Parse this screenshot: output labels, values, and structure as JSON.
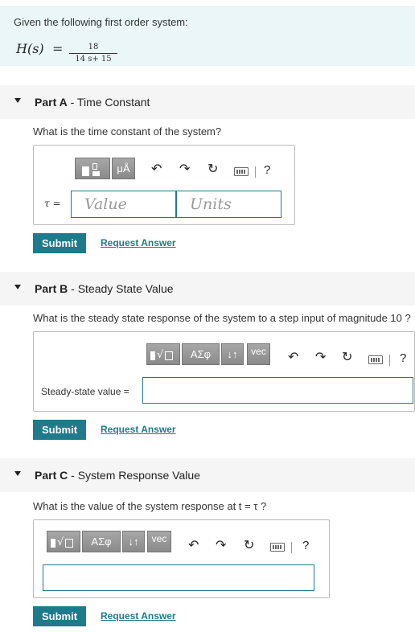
{
  "intro": {
    "text": "Given the following first order system:",
    "lhs": "H(s)",
    "eq": "=",
    "numerator": "18",
    "denominator": "14 s+ 15"
  },
  "parts": [
    {
      "letter": "Part A",
      "dash": " - ",
      "title": "Time Constant",
      "question": "What is the time constant of the system?",
      "toolbar": {
        "template_label": "",
        "units_label": "μÅ",
        "help_label": "?"
      },
      "symbol_label": "τ =",
      "value_placeholder": "Value",
      "units_placeholder": "Units",
      "submit": "Submit",
      "request": "Request Answer"
    },
    {
      "letter": "Part B",
      "dash": " - ",
      "title": "Steady State Value",
      "question": "What is the steady state response of the system to a step input of magnitude  10 ?",
      "toolbar": {
        "greek_label": "ΑΣφ",
        "arrows_label": "↓↑",
        "vec_label": "vec",
        "help_label": "?"
      },
      "field_label": "Steady-state value =",
      "submit": "Submit",
      "request": "Request Answer"
    },
    {
      "letter": "Part C",
      "dash": " - ",
      "title": "System Response Value",
      "question": "What is the value of the system response at t = τ ?",
      "toolbar": {
        "greek_label": "ΑΣφ",
        "arrows_label": "↓↑",
        "vec_label": "vec",
        "help_label": "?"
      },
      "submit": "Submit",
      "request": "Request Answer"
    }
  ],
  "colors": {
    "accent": "#1f7a8c",
    "intro_bg": "#eaf6f7",
    "header_bg": "#f5f5f5",
    "toolbar_button": "#999999"
  }
}
